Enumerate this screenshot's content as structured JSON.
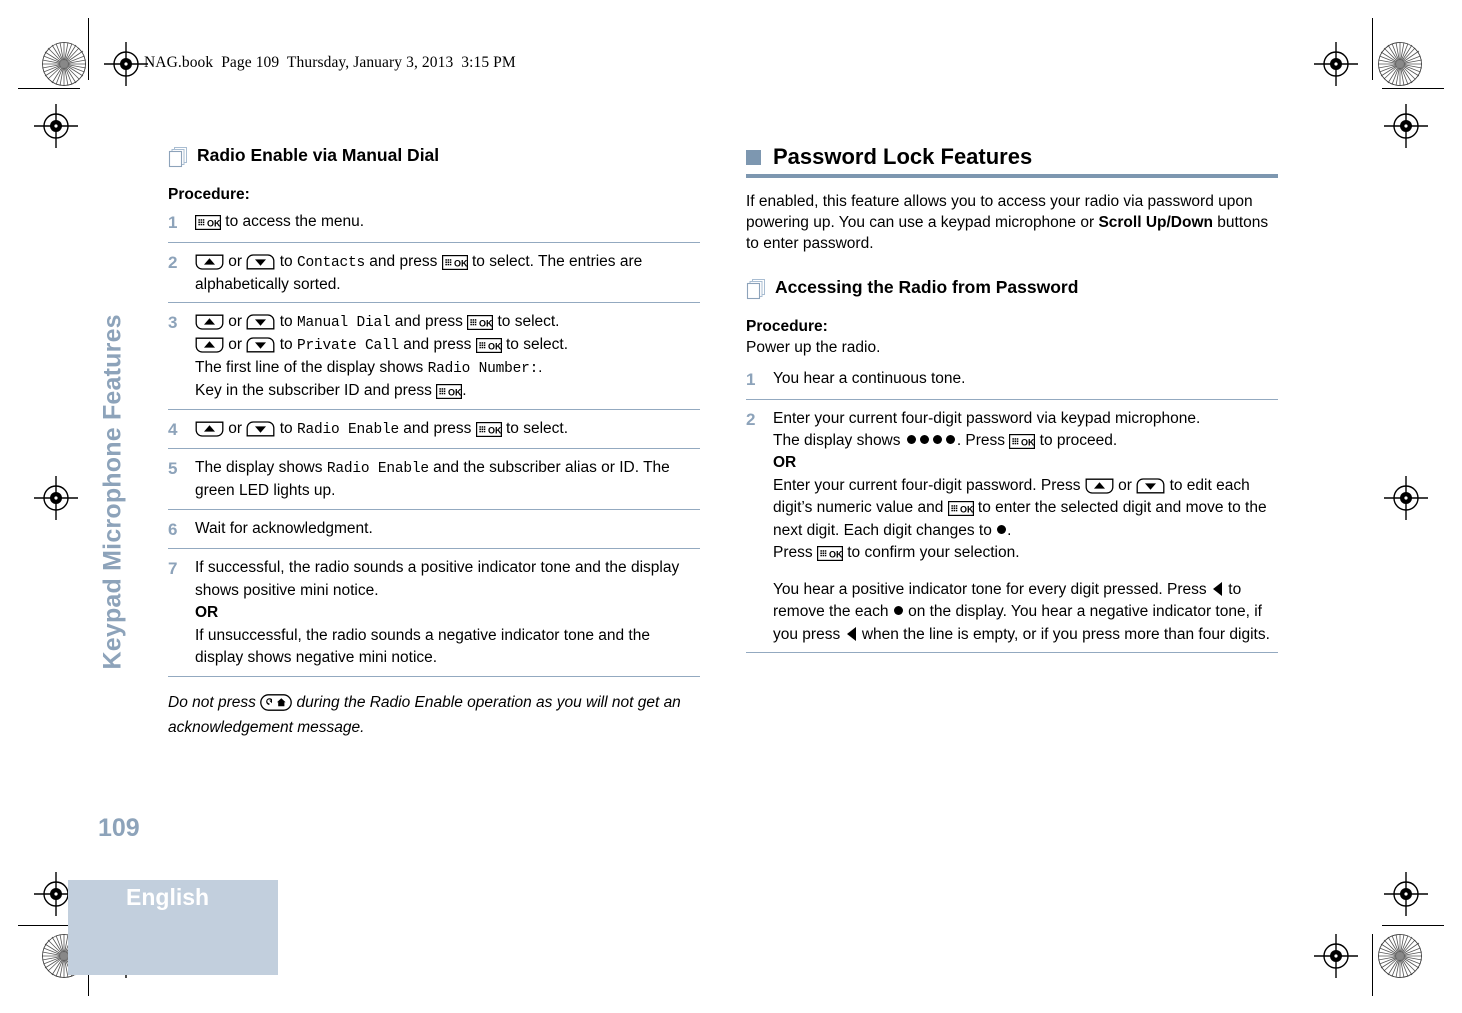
{
  "file_header": "NAG.book  Page 109  Thursday, January 3, 2013  3:15 PM",
  "sidebar": {
    "chapter_title": "Keypad Microphone Features"
  },
  "footer": {
    "page_number": "109",
    "language": "English"
  },
  "colors": {
    "accent": "#7d97b0",
    "accent_light": "#8da3ba",
    "lang_block": "#c2cfdd",
    "rule": "#93a9c0"
  },
  "icons": {
    "ok_button": "ok-key-icon",
    "scroll_up": "scroll-up-key-icon",
    "scroll_down": "scroll-down-key-icon",
    "back_home": "back-home-key-icon",
    "delete_left": "delete-left-key-icon",
    "password_dot": "password-dot-icon",
    "pages": "stacked-pages-icon",
    "square_bullet": "square-bullet-icon"
  },
  "left_column": {
    "heading": "Radio Enable via Manual Dial",
    "procedure_label": "Procedure:",
    "steps": [
      {
        "num": "1",
        "lines": [
          [
            {
              "t": "key",
              "v": "ok"
            },
            {
              "t": "text",
              "v": " to access the menu."
            }
          ]
        ]
      },
      {
        "num": "2",
        "lines": [
          [
            {
              "t": "key",
              "v": "up"
            },
            {
              "t": "text",
              "v": " or "
            },
            {
              "t": "key",
              "v": "down"
            },
            {
              "t": "text",
              "v": " to "
            },
            {
              "t": "mono",
              "v": "Contacts"
            },
            {
              "t": "text",
              "v": " and press "
            },
            {
              "t": "key",
              "v": "ok"
            },
            {
              "t": "text",
              "v": " to select. The entries are alphabetically sorted."
            }
          ]
        ]
      },
      {
        "num": "3",
        "lines": [
          [
            {
              "t": "key",
              "v": "up"
            },
            {
              "t": "text",
              "v": " or "
            },
            {
              "t": "key",
              "v": "down"
            },
            {
              "t": "text",
              "v": " to "
            },
            {
              "t": "mono",
              "v": "Manual Dial"
            },
            {
              "t": "text",
              "v": " and press "
            },
            {
              "t": "key",
              "v": "ok"
            },
            {
              "t": "text",
              "v": " to select."
            }
          ],
          [
            {
              "t": "key",
              "v": "up"
            },
            {
              "t": "text",
              "v": " or "
            },
            {
              "t": "key",
              "v": "down"
            },
            {
              "t": "text",
              "v": " to "
            },
            {
              "t": "mono",
              "v": "Private Call"
            },
            {
              "t": "text",
              "v": " and press "
            },
            {
              "t": "key",
              "v": "ok"
            },
            {
              "t": "text",
              "v": " to select."
            }
          ],
          [
            {
              "t": "text",
              "v": "The first line of the display shows "
            },
            {
              "t": "mono",
              "v": "Radio Number:"
            },
            {
              "t": "text",
              "v": "."
            }
          ],
          [
            {
              "t": "text",
              "v": "Key in the subscriber ID and press "
            },
            {
              "t": "key",
              "v": "ok"
            },
            {
              "t": "text",
              "v": "."
            }
          ]
        ]
      },
      {
        "num": "4",
        "lines": [
          [
            {
              "t": "key",
              "v": "up"
            },
            {
              "t": "text",
              "v": " or "
            },
            {
              "t": "key",
              "v": "down"
            },
            {
              "t": "text",
              "v": " to "
            },
            {
              "t": "mono",
              "v": "Radio Enable"
            },
            {
              "t": "text",
              "v": " and press "
            },
            {
              "t": "key",
              "v": "ok"
            },
            {
              "t": "text",
              "v": " to select."
            }
          ]
        ]
      },
      {
        "num": "5",
        "lines": [
          [
            {
              "t": "text",
              "v": "The display shows "
            },
            {
              "t": "mono",
              "v": "Radio Enable"
            },
            {
              "t": "text",
              "v": " and the subscriber alias or ID. The green LED lights up."
            }
          ]
        ]
      },
      {
        "num": "6",
        "lines": [
          [
            {
              "t": "text",
              "v": "Wait for acknowledgment."
            }
          ]
        ]
      },
      {
        "num": "7",
        "lines": [
          [
            {
              "t": "text",
              "v": "If successful, the radio sounds a positive indicator tone and the display shows positive mini notice."
            }
          ],
          [
            {
              "t": "bold",
              "v": "OR"
            }
          ],
          [
            {
              "t": "text",
              "v": "If unsuccessful, the radio sounds a negative indicator tone and the display shows negative mini notice."
            }
          ]
        ]
      }
    ],
    "note": [
      {
        "t": "text",
        "v": "Do not press "
      },
      {
        "t": "key",
        "v": "backhome"
      },
      {
        "t": "text",
        "v": " during the Radio Enable operation as you will not get an acknowledgement message."
      }
    ]
  },
  "right_column": {
    "main_heading": "Password Lock Features",
    "intro": [
      {
        "t": "text",
        "v": "If enabled, this feature allows you to access your radio via password upon powering up. You can use a keypad microphone or "
      },
      {
        "t": "bold",
        "v": "Scroll Up/Down"
      },
      {
        "t": "text",
        "v": " buttons to enter password."
      }
    ],
    "sub_heading": "Accessing the Radio from Password",
    "procedure_label": "Procedure:",
    "procedure_intro": "Power up the radio.",
    "steps": [
      {
        "num": "1",
        "lines": [
          [
            {
              "t": "text",
              "v": "You hear a continuous tone."
            }
          ]
        ]
      },
      {
        "num": "2",
        "lines": [
          [
            {
              "t": "text",
              "v": "Enter your current four-digit password via keypad microphone."
            }
          ],
          [
            {
              "t": "text",
              "v": "The display shows "
            },
            {
              "t": "dots",
              "v": "4"
            },
            {
              "t": "text",
              "v": ". Press "
            },
            {
              "t": "key",
              "v": "ok"
            },
            {
              "t": "text",
              "v": " to proceed."
            }
          ],
          [
            {
              "t": "bold",
              "v": "OR"
            }
          ],
          [
            {
              "t": "text",
              "v": "Enter your current four-digit password. Press "
            },
            {
              "t": "key",
              "v": "up"
            },
            {
              "t": "text",
              "v": " or "
            },
            {
              "t": "key",
              "v": "down"
            },
            {
              "t": "text",
              "v": " to edit each digit’s numeric value and "
            },
            {
              "t": "key",
              "v": "ok"
            },
            {
              "t": "text",
              "v": " to enter the selected digit and move to the next digit. Each digit changes to "
            },
            {
              "t": "dot",
              "v": "1"
            },
            {
              "t": "text",
              "v": "."
            }
          ],
          [
            {
              "t": "text",
              "v": "Press "
            },
            {
              "t": "key",
              "v": "ok"
            },
            {
              "t": "text",
              "v": " to confirm your selection."
            }
          ],
          [
            {
              "t": "gap",
              "v": ""
            }
          ],
          [
            {
              "t": "text",
              "v": "You hear a positive indicator tone for every digit pressed. Press "
            },
            {
              "t": "key",
              "v": "left"
            },
            {
              "t": "text",
              "v": " to remove the each "
            },
            {
              "t": "dot",
              "v": "1"
            },
            {
              "t": "text",
              "v": " on the display. You hear a negative indicator tone, if you press "
            },
            {
              "t": "key",
              "v": "left"
            },
            {
              "t": "text",
              "v": " when the line is empty, or if you press more than four digits."
            }
          ]
        ]
      }
    ]
  }
}
